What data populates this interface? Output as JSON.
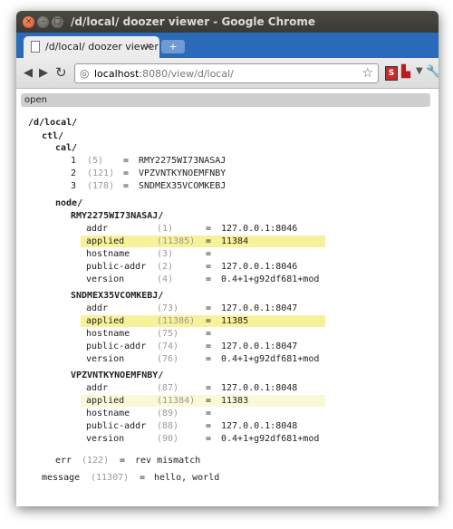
{
  "window": {
    "title": "/d/local/ doozer viewer - Google Chrome"
  },
  "tab": {
    "title": "/d/local/ doozer viewer",
    "close": "×",
    "new_tab": "+"
  },
  "toolbar": {
    "url_host": "localhost",
    "url_path": ":8080/view/d/local/"
  },
  "page": {
    "open_label": "open",
    "root": "/d/local/",
    "ctl": "ctl/",
    "cal": "cal/",
    "cal_items": [
      {
        "key": "1",
        "rev": "(5)",
        "eq": "=",
        "value": "RMY2275WI73NASAJ"
      },
      {
        "key": "2",
        "rev": "(121)",
        "eq": "=",
        "value": "VPZVNTKYNOEMFNBY"
      },
      {
        "key": "3",
        "rev": "(178)",
        "eq": "=",
        "value": "SNDMEX35VCOMKEBJ"
      }
    ],
    "node": "node/",
    "nodes": [
      {
        "name": "RMY2275WI73NASAJ/",
        "fields": [
          {
            "key": "addr",
            "rev": "(1)",
            "eq": "=",
            "value": "127.0.0.1:8046"
          },
          {
            "key": "applied",
            "rev": "(11385)",
            "eq": "=",
            "value": "11384"
          },
          {
            "key": "hostname",
            "rev": "(3)",
            "eq": "=",
            "value": ""
          },
          {
            "key": "public-addr",
            "rev": "(2)",
            "eq": "=",
            "value": "127.0.0.1:8046"
          },
          {
            "key": "version",
            "rev": "(4)",
            "eq": "=",
            "value": "0.4+1+g92df681+mod"
          }
        ]
      },
      {
        "name": "SNDMEX35VCOMKEBJ/",
        "fields": [
          {
            "key": "addr",
            "rev": "(73)",
            "eq": "=",
            "value": "127.0.0.1:8047"
          },
          {
            "key": "applied",
            "rev": "(11386)",
            "eq": "=",
            "value": "11385"
          },
          {
            "key": "hostname",
            "rev": "(75)",
            "eq": "=",
            "value": ""
          },
          {
            "key": "public-addr",
            "rev": "(74)",
            "eq": "=",
            "value": "127.0.0.1:8047"
          },
          {
            "key": "version",
            "rev": "(76)",
            "eq": "=",
            "value": "0.4+1+g92df681+mod"
          }
        ]
      },
      {
        "name": "VPZVNTKYNOEMFNBY/",
        "fields": [
          {
            "key": "addr",
            "rev": "(87)",
            "eq": "=",
            "value": "127.0.0.1:8048"
          },
          {
            "key": "applied",
            "rev": "(11384)",
            "eq": "=",
            "value": "11383"
          },
          {
            "key": "hostname",
            "rev": "(89)",
            "eq": "=",
            "value": ""
          },
          {
            "key": "public-addr",
            "rev": "(88)",
            "eq": "=",
            "value": "127.0.0.1:8048"
          },
          {
            "key": "version",
            "rev": "(90)",
            "eq": "=",
            "value": "0.4+1+g92df681+mod"
          }
        ]
      }
    ],
    "err": {
      "key": "err",
      "rev": "(122)",
      "eq": "=",
      "value": "rev mismatch"
    },
    "message": {
      "key": "message",
      "rev": "(11307)",
      "eq": "=",
      "value": "hello, world"
    }
  }
}
